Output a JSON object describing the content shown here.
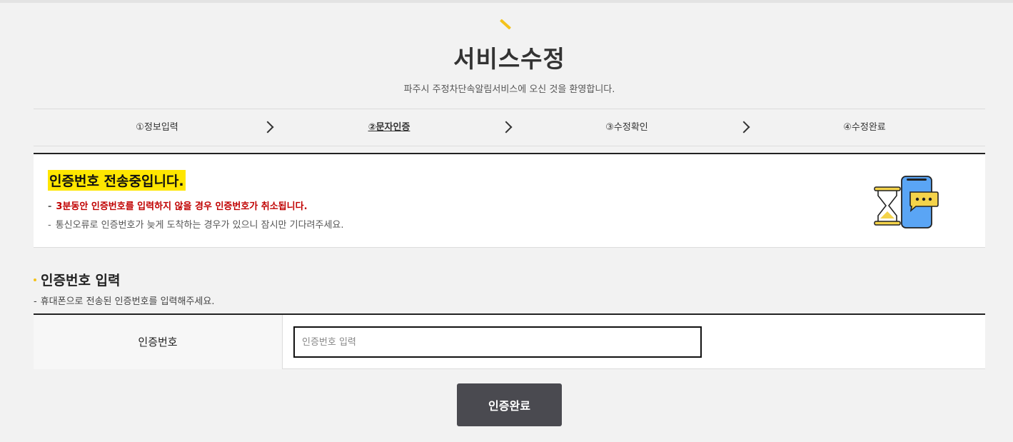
{
  "header": {
    "title": "서비스수정",
    "subtitle": "파주시 주정차단속알림서비스에 오신 것을 환영합니다."
  },
  "steps": [
    {
      "label": "①정보입력",
      "active": false
    },
    {
      "label": "②문자인증",
      "active": true
    },
    {
      "label": "③수정확인",
      "active": false
    },
    {
      "label": "④수정완료",
      "active": false
    }
  ],
  "notice": {
    "title": "인증번호 전송중입니다.",
    "warning": "3분동안 인증번호를 입력하지 않을 경우 인증번호가 취소됩니다.",
    "info": "통신오류로 인증번호가 늦게 도착하는 경우가 있으니 잠시만 기다려주세요.",
    "illustration_icon": "hourglass-phone-chat-icon"
  },
  "section": {
    "title": "인증번호 입력",
    "description": "휴대폰으로 전송된 인증번호를 입력해주세요."
  },
  "form": {
    "label": "인증번호",
    "placeholder": "인증번호 입력",
    "value": ""
  },
  "submit": {
    "label": "인증완료"
  },
  "colors": {
    "accent": "#f4c21b",
    "highlight": "#ffe600",
    "warning": "#c00000",
    "button": "#4a4a50",
    "phone_screen": "#5aa5f5"
  }
}
